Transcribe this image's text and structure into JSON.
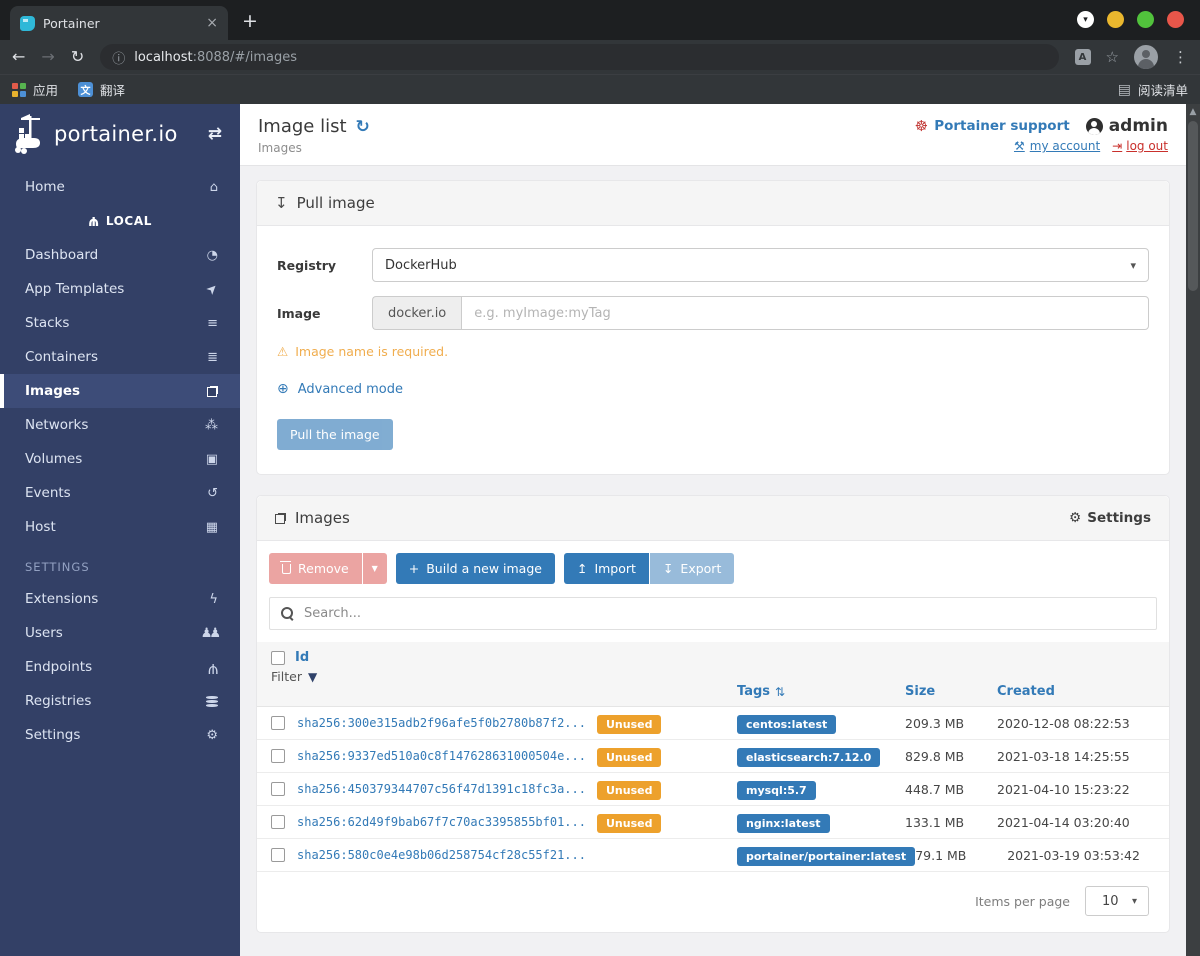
{
  "browser": {
    "tab_title": "Portainer",
    "tab_close": "×",
    "new_tab": "+",
    "url_host": "localhost",
    "url_rest": ":8088/#/images",
    "bookmarks": {
      "apps": "应用",
      "translate": "翻译",
      "reading_list": "阅读清单"
    },
    "icons": {
      "back": "←",
      "forward": "→",
      "reload": "↻",
      "info": "ⓘ",
      "star": "☆",
      "menu": "⋮",
      "win_caret": "▾",
      "reading": "▤",
      "translate_glyph": "A",
      "gt_glyph": "文"
    }
  },
  "sidebar": {
    "logo": "portainer.io",
    "collapse_icon": "⇄",
    "items": [
      {
        "label": "Home",
        "glyph": "⌂"
      },
      {
        "label": "LOCAL",
        "glyph": "Ψ"
      },
      {
        "label": "Dashboard",
        "glyph": "◔"
      },
      {
        "label": "App Templates",
        "glyph": "➤"
      },
      {
        "label": "Stacks",
        "glyph": "≡"
      },
      {
        "label": "Containers",
        "glyph": "≣"
      },
      {
        "label": "Images"
      },
      {
        "label": "Networks",
        "glyph": "⁂"
      },
      {
        "label": "Volumes",
        "glyph": "▣"
      },
      {
        "label": "Events",
        "glyph": "↺"
      },
      {
        "label": "Host",
        "glyph": "▦"
      },
      {
        "label": "SETTINGS"
      },
      {
        "label": "Extensions",
        "glyph": "ϟ"
      },
      {
        "label": "Users",
        "glyph": "♟♟"
      },
      {
        "label": "Endpoints",
        "glyph": "Ψ"
      },
      {
        "label": "Registries"
      },
      {
        "label": "Settings",
        "glyph": "⚙"
      }
    ]
  },
  "header": {
    "title": "Image list",
    "refresh_icon": "↻",
    "subtitle": "Images",
    "support": "Portainer support",
    "lifering_icon": "☸",
    "user": "admin",
    "my_account": "my account",
    "wrench_icon": "⚒",
    "log_out": "log out",
    "logout_icon": "⇥"
  },
  "pull_panel": {
    "title": "Pull image",
    "download_icon": "↧",
    "registry_label": "Registry",
    "registry_value": "DockerHub",
    "image_label": "Image",
    "image_prefix": "docker.io",
    "image_placeholder": "e.g. myImage:myTag",
    "warning_icon": "⚠",
    "warning": "Image name is required.",
    "globe_icon": "⊕",
    "advanced": "Advanced mode",
    "submit": "Pull the image",
    "caret": "▾"
  },
  "images_panel": {
    "title": "Images",
    "settings_label": "Settings",
    "gear_icon": "⚙",
    "remove_label": "Remove",
    "remove_caret": "▼",
    "build_label": "Build a new image",
    "plus_icon": "+",
    "import_label": "Import",
    "upload_icon": "↥",
    "export_label": "Export",
    "download_icon": "↧",
    "search_placeholder": "Search...",
    "columns": {
      "id": "Id",
      "filter": "Filter",
      "funnel_icon": "▼",
      "tags": "Tags",
      "sort_icon": "⇅",
      "size": "Size",
      "created": "Created"
    },
    "rows": [
      {
        "id": "sha256:300e315adb2f96afe5f0b2780b87f2...",
        "badge": "Unused",
        "tag": "centos:latest",
        "size": "209.3 MB",
        "created": "2020-12-08 08:22:53"
      },
      {
        "id": "sha256:9337ed510a0c8f147628631000504e...",
        "badge": "Unused",
        "tag": "elasticsearch:7.12.0",
        "size": "829.8 MB",
        "created": "2021-03-18 14:25:55"
      },
      {
        "id": "sha256:450379344707c56f47d1391c18fc3a...",
        "badge": "Unused",
        "tag": "mysql:5.7",
        "size": "448.7 MB",
        "created": "2021-04-10 15:23:22"
      },
      {
        "id": "sha256:62d49f9bab67f7c70ac3395855bf01...",
        "badge": "Unused",
        "tag": "nginx:latest",
        "size": "133.1 MB",
        "created": "2021-04-14 03:20:40"
      },
      {
        "id": "sha256:580c0e4e98b06d258754cf28c55f21...",
        "badge": null,
        "tag": "portainer/portainer:latest",
        "size": "79.1 MB",
        "created": "2021-03-19 03:53:42"
      }
    ],
    "footer": {
      "label": "Items per page",
      "value": "10",
      "caret": "▾"
    }
  },
  "colors": {
    "accent_blue": "#337ab7",
    "sidebar_navy": "#334066",
    "badge_orange": "#eda12c",
    "warning_orange": "#f0ad4e",
    "danger_red": "#d9534f",
    "chrome_dark": "#323639"
  }
}
